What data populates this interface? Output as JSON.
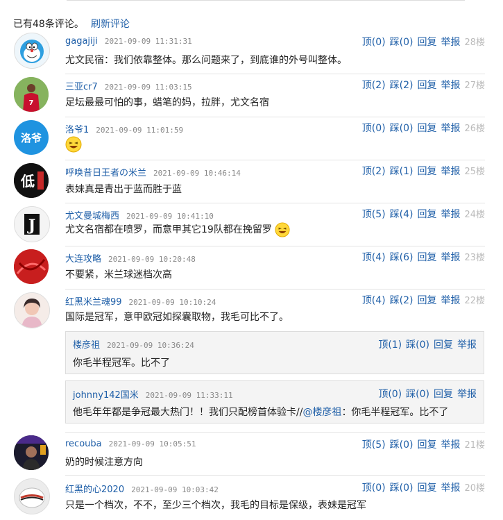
{
  "summary": {
    "count_text": "已有48条评论。",
    "refresh": "刷新评论"
  },
  "actions": {
    "up_prefix": "顶",
    "down_prefix": "踩",
    "reply": "回复",
    "report": "举报"
  },
  "comments": [
    {
      "user": "gagajiji",
      "time": "2021-09-09 11:31:31",
      "up": "(0)",
      "down": "(0)",
      "floor": "28楼",
      "text": "尤文民宿：我们依靠整体。那么问题来了，到底谁的外号叫整体。",
      "avatar_text": ""
    },
    {
      "user": "三亚cr7",
      "time": "2021-09-09 11:03:15",
      "up": "(2)",
      "down": "(2)",
      "floor": "27楼",
      "text": "足坛最最可怕的事，蜡笔的妈，拉胖，尤文名宿",
      "avatar_text": "7"
    },
    {
      "user": "洛爷1",
      "time": "2021-09-09 11:01:59",
      "up": "(0)",
      "down": "(0)",
      "floor": "26楼",
      "text": "",
      "avatar_text": "洛爷"
    },
    {
      "user": "呼唤昔日王者の米兰",
      "time": "2021-09-09 10:46:14",
      "up": "(2)",
      "down": "(1)",
      "floor": "25楼",
      "text": "表妹真是青出于蓝而胜于蓝",
      "avatar_text": "低"
    },
    {
      "user": "尤文曼城梅西",
      "time": "2021-09-09 10:41:10",
      "up": "(5)",
      "down": "(4)",
      "floor": "24楼",
      "text": "尤文名宿都在喷罗，而意甲其它19队都在挽留罗",
      "avatar_text": "J"
    },
    {
      "user": "大连攻略",
      "time": "2021-09-09 10:20:48",
      "up": "(4)",
      "down": "(6)",
      "floor": "23楼",
      "text": "不要紧，米兰球迷档次高",
      "avatar_text": ""
    },
    {
      "user": "红黑米兰魂99",
      "time": "2021-09-09 10:10:24",
      "up": "(4)",
      "down": "(2)",
      "floor": "22楼",
      "text": "国际是冠军，意甲欧冠如探囊取物，我毛可比不了。",
      "avatar_text": ""
    },
    {
      "user": "recouba",
      "time": "2021-09-09 10:05:51",
      "up": "(5)",
      "down": "(0)",
      "floor": "21楼",
      "text": "奶的时候注意方向",
      "avatar_text": ""
    },
    {
      "user": "红黑的心2020",
      "time": "2021-09-09 10:03:42",
      "up": "(0)",
      "down": "(0)",
      "floor": "20楼",
      "text": "只是一个档次，不不，至少三个档次，我毛的目标是保级，表妹是冠军",
      "avatar_text": ""
    }
  ],
  "replies": [
    {
      "user": "楼彦祖",
      "time": "2021-09-09 10:36:24",
      "up": "(1)",
      "down": "(0)",
      "text": "你毛半程冠军。比不了"
    },
    {
      "user": "johnny142国米",
      "time": "2021-09-09 11:33:11",
      "up": "(0)",
      "down": "(0)",
      "text_before": "他毛年年都是争冠最大热门！！我们只配榜首体验卡//",
      "mention": "@楼彦祖",
      "text_after": "：你毛半程冠军。比不了"
    }
  ],
  "colors": {
    "link": "#1f5fa8",
    "floor": "#bbbbbb",
    "time": "#888888"
  }
}
